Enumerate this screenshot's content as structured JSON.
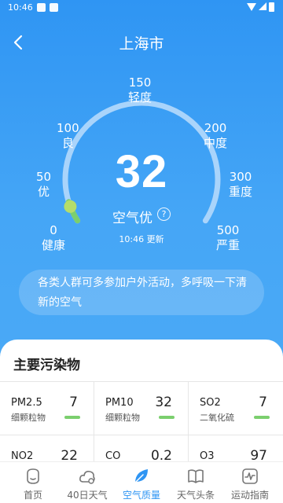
{
  "status_bar": {
    "time": "10:46"
  },
  "header": {
    "title": "上海市"
  },
  "gauge": {
    "aqi_value": "32",
    "level": "空气优",
    "help_glyph": "?",
    "updated": "10:46 更新",
    "max": 500,
    "scale": [
      {
        "value": "0",
        "label": "健康"
      },
      {
        "value": "50",
        "label": "优"
      },
      {
        "value": "100",
        "label": "良"
      },
      {
        "value": "150",
        "label": "轻度"
      },
      {
        "value": "200",
        "label": "中度"
      },
      {
        "value": "300",
        "label": "重度"
      },
      {
        "value": "500",
        "label": "严重"
      }
    ]
  },
  "advice": "各类人群可多参加户外活动，多呼吸一下清新的空气",
  "pollutants": {
    "title": "主要污染物",
    "items": [
      {
        "name": "PM2.5",
        "desc": "细颗粒物",
        "value": "7"
      },
      {
        "name": "PM10",
        "desc": "细颗粒物",
        "value": "32"
      },
      {
        "name": "SO2",
        "desc": "二氧化硫",
        "value": "7"
      },
      {
        "name": "NO2",
        "desc": "",
        "value": "22"
      },
      {
        "name": "CO",
        "desc": "",
        "value": "0.2"
      },
      {
        "name": "O3",
        "desc": "",
        "value": "97"
      }
    ]
  },
  "nav": {
    "items": [
      {
        "label": "首页",
        "icon": "home-face-icon",
        "active": false
      },
      {
        "label": "40日天气",
        "icon": "cloud-icon",
        "active": false
      },
      {
        "label": "空气质量",
        "icon": "leaf-icon",
        "active": true
      },
      {
        "label": "天气头条",
        "icon": "book-icon",
        "active": false
      },
      {
        "label": "运动指南",
        "icon": "pulse-icon",
        "active": false
      }
    ]
  },
  "colors": {
    "accent": "#2f95f3",
    "good": "#7bcf6e",
    "gauge_track": "#a9d4fb"
  }
}
